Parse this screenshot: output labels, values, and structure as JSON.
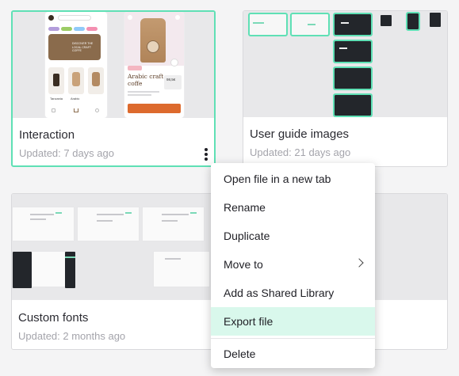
{
  "projects": [
    {
      "title": "Interaction",
      "updated": "Updated: 7 days ago"
    },
    {
      "title": "User guide images",
      "updated": "Updated: 21 days ago"
    },
    {
      "title": "Custom fonts",
      "updated": "Updated: 2 months ago"
    }
  ],
  "thumb_interaction": {
    "banner_text": "DISCOVER THE LOCAL CRAFT COFFE",
    "product_title": "Arabic craft coffe",
    "price": "98,5€",
    "item_labels": [
      "Tanzania",
      "Arabic",
      ""
    ]
  },
  "context_menu": {
    "items": [
      {
        "label": "Open file in a new tab"
      },
      {
        "label": "Rename"
      },
      {
        "label": "Duplicate"
      },
      {
        "label": "Move to"
      },
      {
        "label": "Add as Shared Library"
      },
      {
        "label": "Export file"
      },
      {
        "label": "Delete"
      }
    ],
    "highlighted_item": "Export file"
  },
  "colors": {
    "accent": "#5fe0b5",
    "highlight_bg": "#d9f8ec",
    "coffee_brown": "#8a6b4c",
    "orange": "#dd6a2d"
  }
}
